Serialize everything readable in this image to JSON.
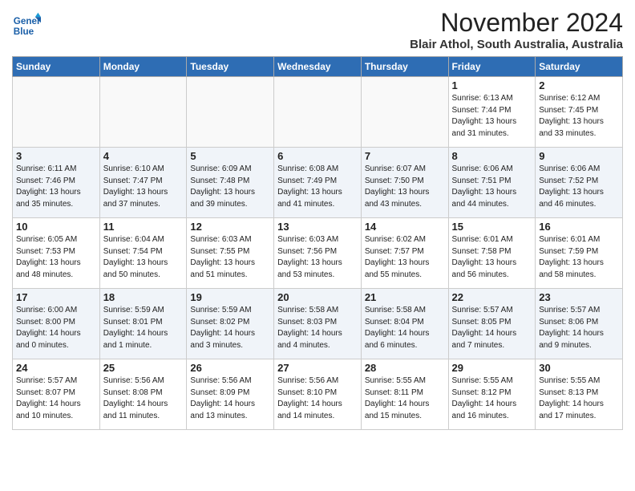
{
  "header": {
    "logo_line1": "General",
    "logo_line2": "Blue",
    "month": "November 2024",
    "location": "Blair Athol, South Australia, Australia"
  },
  "weekdays": [
    "Sunday",
    "Monday",
    "Tuesday",
    "Wednesday",
    "Thursday",
    "Friday",
    "Saturday"
  ],
  "weeks": [
    [
      {
        "day": "",
        "info": ""
      },
      {
        "day": "",
        "info": ""
      },
      {
        "day": "",
        "info": ""
      },
      {
        "day": "",
        "info": ""
      },
      {
        "day": "",
        "info": ""
      },
      {
        "day": "1",
        "info": "Sunrise: 6:13 AM\nSunset: 7:44 PM\nDaylight: 13 hours\nand 31 minutes."
      },
      {
        "day": "2",
        "info": "Sunrise: 6:12 AM\nSunset: 7:45 PM\nDaylight: 13 hours\nand 33 minutes."
      }
    ],
    [
      {
        "day": "3",
        "info": "Sunrise: 6:11 AM\nSunset: 7:46 PM\nDaylight: 13 hours\nand 35 minutes."
      },
      {
        "day": "4",
        "info": "Sunrise: 6:10 AM\nSunset: 7:47 PM\nDaylight: 13 hours\nand 37 minutes."
      },
      {
        "day": "5",
        "info": "Sunrise: 6:09 AM\nSunset: 7:48 PM\nDaylight: 13 hours\nand 39 minutes."
      },
      {
        "day": "6",
        "info": "Sunrise: 6:08 AM\nSunset: 7:49 PM\nDaylight: 13 hours\nand 41 minutes."
      },
      {
        "day": "7",
        "info": "Sunrise: 6:07 AM\nSunset: 7:50 PM\nDaylight: 13 hours\nand 43 minutes."
      },
      {
        "day": "8",
        "info": "Sunrise: 6:06 AM\nSunset: 7:51 PM\nDaylight: 13 hours\nand 44 minutes."
      },
      {
        "day": "9",
        "info": "Sunrise: 6:06 AM\nSunset: 7:52 PM\nDaylight: 13 hours\nand 46 minutes."
      }
    ],
    [
      {
        "day": "10",
        "info": "Sunrise: 6:05 AM\nSunset: 7:53 PM\nDaylight: 13 hours\nand 48 minutes."
      },
      {
        "day": "11",
        "info": "Sunrise: 6:04 AM\nSunset: 7:54 PM\nDaylight: 13 hours\nand 50 minutes."
      },
      {
        "day": "12",
        "info": "Sunrise: 6:03 AM\nSunset: 7:55 PM\nDaylight: 13 hours\nand 51 minutes."
      },
      {
        "day": "13",
        "info": "Sunrise: 6:03 AM\nSunset: 7:56 PM\nDaylight: 13 hours\nand 53 minutes."
      },
      {
        "day": "14",
        "info": "Sunrise: 6:02 AM\nSunset: 7:57 PM\nDaylight: 13 hours\nand 55 minutes."
      },
      {
        "day": "15",
        "info": "Sunrise: 6:01 AM\nSunset: 7:58 PM\nDaylight: 13 hours\nand 56 minutes."
      },
      {
        "day": "16",
        "info": "Sunrise: 6:01 AM\nSunset: 7:59 PM\nDaylight: 13 hours\nand 58 minutes."
      }
    ],
    [
      {
        "day": "17",
        "info": "Sunrise: 6:00 AM\nSunset: 8:00 PM\nDaylight: 14 hours\nand 0 minutes."
      },
      {
        "day": "18",
        "info": "Sunrise: 5:59 AM\nSunset: 8:01 PM\nDaylight: 14 hours\nand 1 minute."
      },
      {
        "day": "19",
        "info": "Sunrise: 5:59 AM\nSunset: 8:02 PM\nDaylight: 14 hours\nand 3 minutes."
      },
      {
        "day": "20",
        "info": "Sunrise: 5:58 AM\nSunset: 8:03 PM\nDaylight: 14 hours\nand 4 minutes."
      },
      {
        "day": "21",
        "info": "Sunrise: 5:58 AM\nSunset: 8:04 PM\nDaylight: 14 hours\nand 6 minutes."
      },
      {
        "day": "22",
        "info": "Sunrise: 5:57 AM\nSunset: 8:05 PM\nDaylight: 14 hours\nand 7 minutes."
      },
      {
        "day": "23",
        "info": "Sunrise: 5:57 AM\nSunset: 8:06 PM\nDaylight: 14 hours\nand 9 minutes."
      }
    ],
    [
      {
        "day": "24",
        "info": "Sunrise: 5:57 AM\nSunset: 8:07 PM\nDaylight: 14 hours\nand 10 minutes."
      },
      {
        "day": "25",
        "info": "Sunrise: 5:56 AM\nSunset: 8:08 PM\nDaylight: 14 hours\nand 11 minutes."
      },
      {
        "day": "26",
        "info": "Sunrise: 5:56 AM\nSunset: 8:09 PM\nDaylight: 14 hours\nand 13 minutes."
      },
      {
        "day": "27",
        "info": "Sunrise: 5:56 AM\nSunset: 8:10 PM\nDaylight: 14 hours\nand 14 minutes."
      },
      {
        "day": "28",
        "info": "Sunrise: 5:55 AM\nSunset: 8:11 PM\nDaylight: 14 hours\nand 15 minutes."
      },
      {
        "day": "29",
        "info": "Sunrise: 5:55 AM\nSunset: 8:12 PM\nDaylight: 14 hours\nand 16 minutes."
      },
      {
        "day": "30",
        "info": "Sunrise: 5:55 AM\nSunset: 8:13 PM\nDaylight: 14 hours\nand 17 minutes."
      }
    ]
  ]
}
